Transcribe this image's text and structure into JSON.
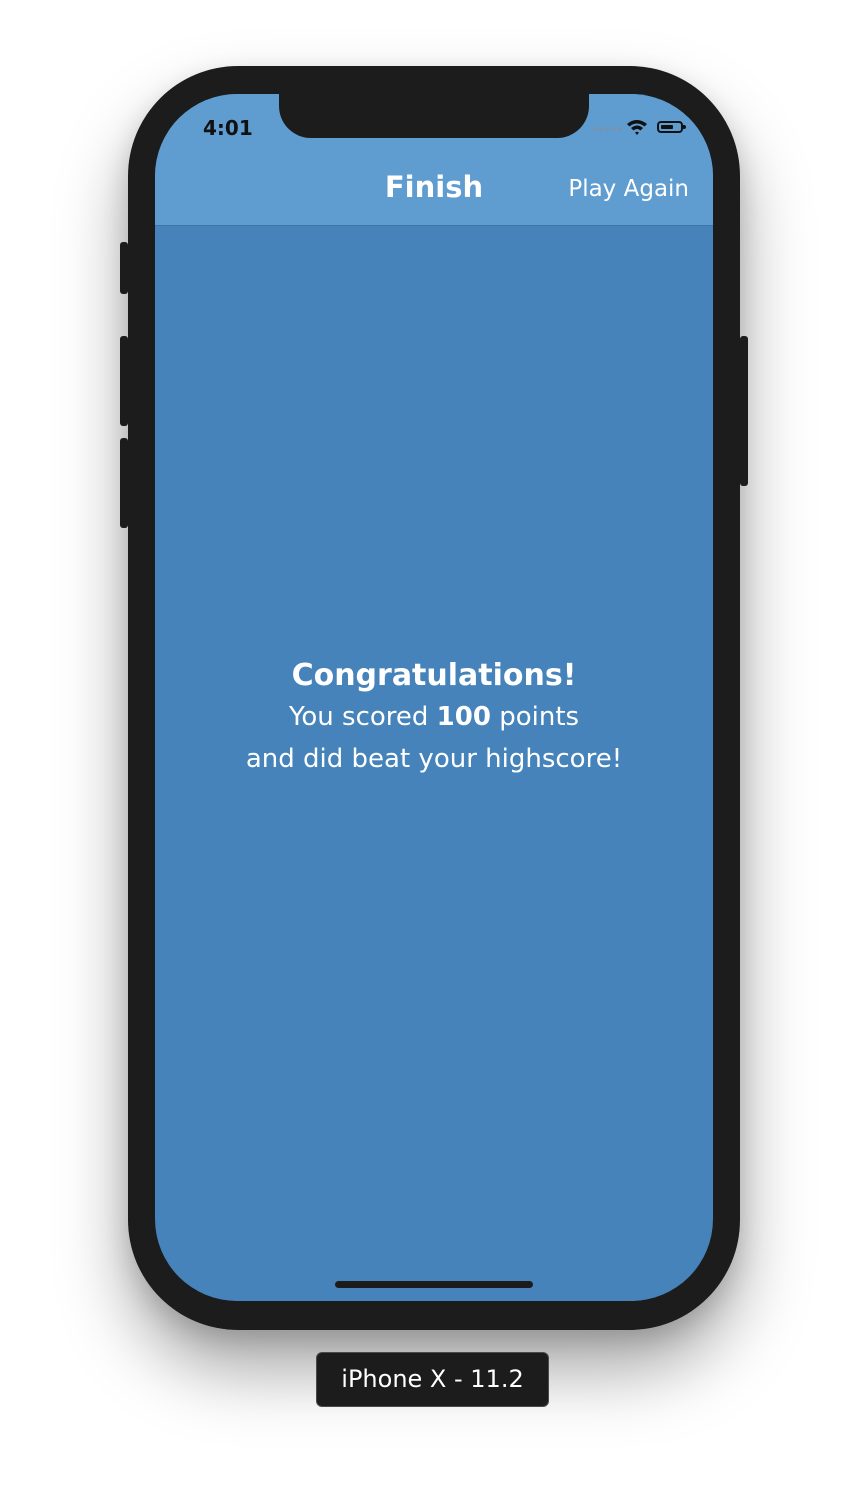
{
  "status_bar": {
    "time": "4:01"
  },
  "nav": {
    "title": "Finish",
    "action_label": "Play Again"
  },
  "result": {
    "headline": "Congratulations!",
    "score_prefix": "You scored ",
    "score_value": "100",
    "score_suffix": " points",
    "subline": "and did beat your highscore!"
  },
  "simulator": {
    "device_label": "iPhone X - 11.2"
  },
  "colors": {
    "navbar": "#5f9ccf",
    "background": "#4683ba",
    "text": "#ffffff"
  }
}
